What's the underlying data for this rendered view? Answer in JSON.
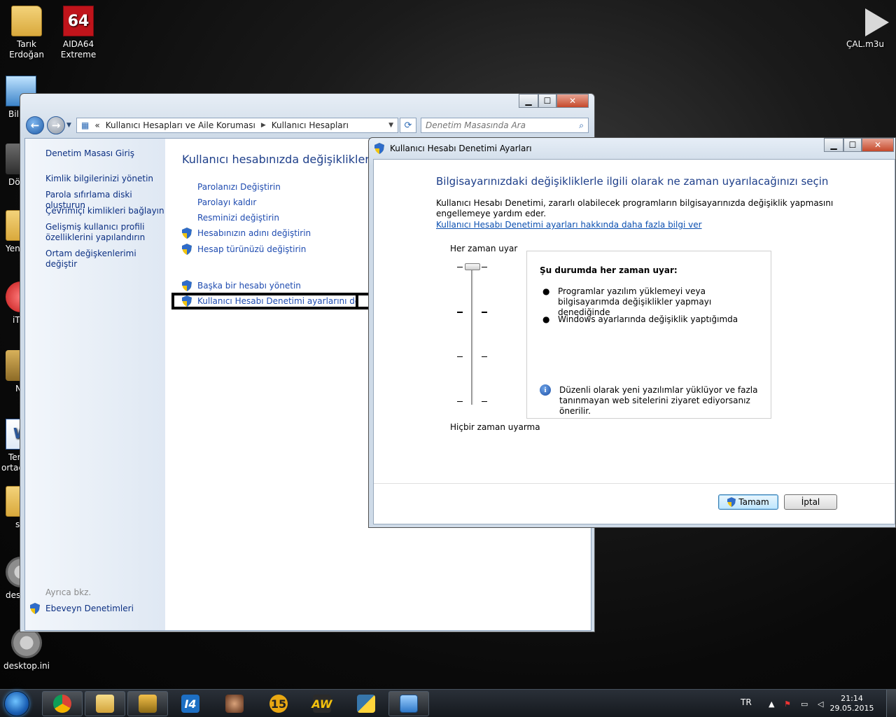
{
  "desktop": {
    "icons": [
      {
        "label": "Tarık\nErdoğan",
        "label1": "Tarık",
        "label2": "Erdoğan"
      },
      {
        "label1": "AIDA64",
        "label2": "Extreme",
        "badge": "64"
      },
      {
        "label1": "ÇAL.m3u"
      },
      {
        "label1": "Bil"
      },
      {
        "label1": "Dö"
      },
      {
        "label1": "Yen"
      },
      {
        "label1": "iT"
      },
      {
        "label1": "N"
      },
      {
        "label1": "Ter",
        "label2": "ortac"
      },
      {
        "label1": "s"
      },
      {
        "label1": "des"
      },
      {
        "label1": "desktop.ini"
      }
    ]
  },
  "control_panel": {
    "address": {
      "root": "«",
      "crumbs": [
        "Kullanıcı Hesapları ve Aile Koruması",
        "Kullanıcı Hesapları"
      ]
    },
    "search_placeholder": "Denetim Masasında Ara",
    "sidebar": {
      "home": "Denetim Masası Giriş",
      "links": [
        "Kimlik bilgilerinizi yönetin",
        "Parola sıfırlama diski oluşturun",
        "Çevrimiçi kimlikleri bağlayın",
        "Gelişmiş kullanıcı profili özelliklerini yapılandırın",
        "Ortam değişkenlerimi değiştir"
      ],
      "see_also_heading": "Ayrıca bkz.",
      "see_also_link": "Ebeveyn Denetimleri"
    },
    "main": {
      "title": "Kullanıcı hesabınızda değişiklikler yapın",
      "tasks": [
        "Parolanızı Değiştirin",
        "Parolayı kaldır",
        "Resminizi değiştirin",
        "Hesabınızın adını değiştirin",
        "Hesap türünüzü değiştirin"
      ],
      "other_tasks": [
        "Başka bir hesabı yönetin",
        "Kullanıcı Hesabı Denetimi ayarlarını değiştirin"
      ]
    },
    "caption": {
      "minimize": "▁",
      "maximize": "☐",
      "close": "✕"
    }
  },
  "uac_dialog": {
    "title": "Kullanıcı Hesabı Denetimi Ayarları",
    "heading": "Bilgisayarınızdaki değişikliklerle ilgili olarak ne zaman uyarılacağınızı seçin",
    "description": "Kullanıcı Hesabı Denetimi, zararlı olabilecek programların bilgisayarınızda değişiklik yapmasını engellemeye yardım eder.",
    "link": "Kullanıcı Hesabı Denetimi ayarları hakkında daha fazla bilgi ver",
    "slider": {
      "top_label": "Her zaman uyar",
      "bottom_label": "Hiçbir zaman uyarma",
      "levels": 4,
      "selected_level": 4
    },
    "info": {
      "title": "Şu durumda her zaman uyar:",
      "bullets": [
        "Programlar yazılım yüklemeyi veya bilgisayarımda değişiklikler yapmayı denediğinde",
        "Windows ayarlarında değişiklik yaptığımda"
      ],
      "note": "Düzenli olarak yeni yazılımlar yüklüyor ve fazla tanınmayan web sitelerini ziyaret ediyorsanız önerilir."
    },
    "buttons": {
      "ok": "Tamam",
      "cancel": "İptal"
    }
  },
  "taskbar": {
    "pinned": [
      "chrome-icon",
      "explorer-icon",
      "winamp-icon",
      "i4-icon",
      "media-icon",
      "15-icon",
      "aw-icon",
      "python-icon",
      "control-panel-icon"
    ],
    "labels": {
      "i4": "I4",
      "fifteen": "15",
      "aw": "AW"
    },
    "tray": {
      "language": "TR",
      "time": "21:14",
      "date": "29.05.2015"
    }
  },
  "colors": {
    "link_blue": "#1e4bb0",
    "heading_blue": "#1e3f8a",
    "accent": "#3c7fb1"
  }
}
